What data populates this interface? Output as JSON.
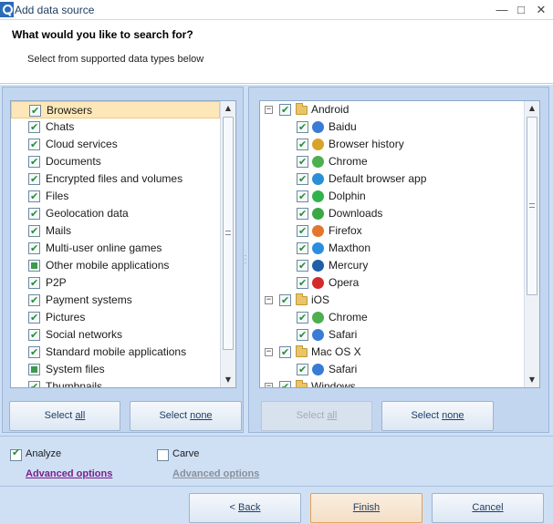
{
  "window": {
    "title": "Add data source",
    "min_icon": "—",
    "max_icon": "□",
    "close_icon": "✕"
  },
  "header": {
    "title": "What would you like to search for?",
    "subtitle": "Select from supported data types below"
  },
  "categories": {
    "items": [
      {
        "label": "Browsers",
        "state": "checked",
        "selected": true
      },
      {
        "label": "Chats",
        "state": "checked"
      },
      {
        "label": "Cloud services",
        "state": "checked"
      },
      {
        "label": "Documents",
        "state": "checked"
      },
      {
        "label": "Encrypted files and volumes",
        "state": "checked"
      },
      {
        "label": "Files",
        "state": "checked"
      },
      {
        "label": "Geolocation data",
        "state": "checked"
      },
      {
        "label": "Mails",
        "state": "checked"
      },
      {
        "label": "Multi-user online games",
        "state": "checked"
      },
      {
        "label": "Other mobile applications",
        "state": "partial"
      },
      {
        "label": "P2P",
        "state": "checked"
      },
      {
        "label": "Payment systems",
        "state": "checked"
      },
      {
        "label": "Pictures",
        "state": "checked"
      },
      {
        "label": "Social networks",
        "state": "checked"
      },
      {
        "label": "Standard mobile applications",
        "state": "checked"
      },
      {
        "label": "System files",
        "state": "partial"
      },
      {
        "label": "Thumbnails",
        "state": "checked"
      }
    ],
    "select_all_label": "all",
    "select_all_prefix": "Select ",
    "select_none_prefix": "Select ",
    "select_none_label": "none"
  },
  "tree": {
    "items": [
      {
        "label": "Android",
        "level": 0,
        "expander": "−",
        "icon": "folder-icon"
      },
      {
        "label": "Baidu",
        "level": 1,
        "icon": "baidu-icon",
        "color": "#3a7bd5"
      },
      {
        "label": "Browser history",
        "level": 1,
        "icon": "browser-history-icon",
        "color": "#d9a32b"
      },
      {
        "label": "Chrome",
        "level": 1,
        "icon": "chrome-icon",
        "color": "#4caf50"
      },
      {
        "label": "Default browser app",
        "level": 1,
        "icon": "default-browser-icon",
        "color": "#2b8fd6"
      },
      {
        "label": "Dolphin",
        "level": 1,
        "icon": "dolphin-icon",
        "color": "#31b34a"
      },
      {
        "label": "Downloads",
        "level": 1,
        "icon": "downloads-icon",
        "color": "#39a845"
      },
      {
        "label": "Firefox",
        "level": 1,
        "icon": "firefox-icon",
        "color": "#e5742c"
      },
      {
        "label": "Maxthon",
        "level": 1,
        "icon": "maxthon-icon",
        "color": "#2a8ee0"
      },
      {
        "label": "Mercury",
        "level": 1,
        "icon": "mercury-icon",
        "color": "#1f5fa8"
      },
      {
        "label": "Opera",
        "level": 1,
        "icon": "opera-icon",
        "color": "#d42a2a"
      },
      {
        "label": "iOS",
        "level": 0,
        "expander": "−",
        "icon": "folder-icon"
      },
      {
        "label": "Chrome",
        "level": 1,
        "icon": "chrome-icon",
        "color": "#4caf50"
      },
      {
        "label": "Safari",
        "level": 1,
        "icon": "safari-icon",
        "color": "#3a7bd5"
      },
      {
        "label": "Mac OS X",
        "level": 0,
        "expander": "−",
        "icon": "folder-icon"
      },
      {
        "label": "Safari",
        "level": 1,
        "icon": "safari-icon",
        "color": "#3a7bd5"
      },
      {
        "label": "Windows",
        "level": 0,
        "expander": "−",
        "icon": "folder-icon"
      }
    ],
    "select_all_prefix": "Select ",
    "select_all_label": "all",
    "select_none_prefix": "Select ",
    "select_none_label": "none"
  },
  "options": {
    "analyze_label": "Analyze",
    "analyze_checked": true,
    "carve_label": "Carve",
    "carve_checked": false,
    "advanced_left": "Advanced options",
    "advanced_right": "Advanced options",
    "advanced_left_color": "#7a1f8a",
    "advanced_right_color": "#8a8f99"
  },
  "footer": {
    "back_prefix": "< ",
    "back_label": "Back",
    "finish_label": "Finish",
    "cancel_label": "Cancel"
  }
}
